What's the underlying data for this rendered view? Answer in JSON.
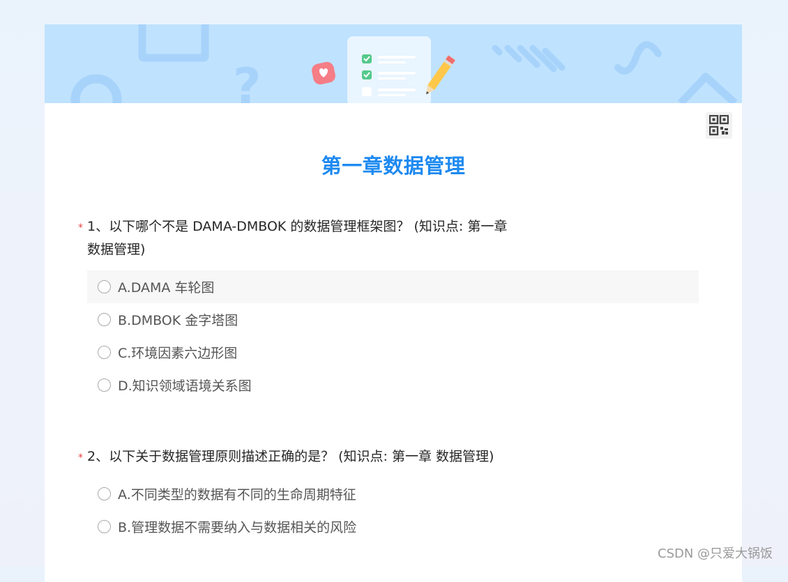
{
  "survey": {
    "title": "第一章数据管理",
    "questions": [
      {
        "number": "1、",
        "text": "以下哪个不是 DAMA-DMBOK 的数据管理框架图？ (知识点: 第一章 数据管理)",
        "required_mark": "*",
        "options": [
          "A.DAMA 车轮图",
          "B.DMBOK 金字塔图",
          "C.环境因素六边形图",
          "D.知识领域语境关系图"
        ]
      },
      {
        "number": "2、",
        "text": "以下关于数据管理原则描述正确的是？ (知识点: 第一章 数据管理)",
        "required_mark": "*",
        "options": [
          "A.不同类型的数据有不同的生命周期特征",
          "B.管理数据不需要纳入与数据相关的风险"
        ]
      }
    ]
  },
  "icons": {
    "qr_code": "qr-code-icon",
    "banner": "checklist-pencil-illustration"
  },
  "colors": {
    "title": "#1e8af0",
    "banner_bg": "#bfe2fe",
    "required": "#e64340"
  },
  "watermark": "CSDN @只爱大锅饭"
}
